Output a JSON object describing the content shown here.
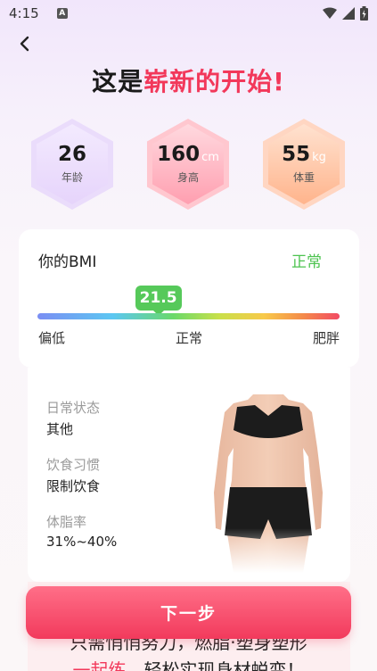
{
  "status_bar": {
    "time": "4:15",
    "a_icon": "A"
  },
  "header": {
    "title_part1": "这是",
    "title_accent": "崭新的开始",
    "title_end": "!"
  },
  "stats": {
    "age": {
      "value": "26",
      "unit": "",
      "label": "年龄"
    },
    "height": {
      "value": "160",
      "unit": "cm",
      "label": "身高"
    },
    "weight": {
      "value": "55",
      "unit": "kg",
      "label": "体重"
    }
  },
  "bmi": {
    "title": "你的BMI",
    "status": "正常",
    "value": "21.5",
    "scale_low": "偏低",
    "scale_normal": "正常",
    "scale_high": "肥胖",
    "indicator_fraction": 0.4
  },
  "info": {
    "daily_label": "日常状态",
    "daily_value": "其他",
    "diet_label": "饮食习惯",
    "diet_value": "限制饮食",
    "fat_label": "体脂率",
    "fat_value": "31%~40%"
  },
  "bottom": {
    "line1": "只需悄悄努力，燃脂·塑身塑形",
    "line2_red": "一起练",
    "line2_rest": "，轻松实现身材蜕变！"
  },
  "next_button": "下一步",
  "colors": {
    "accent": "#f2385a",
    "normal_green": "#56c95a"
  }
}
